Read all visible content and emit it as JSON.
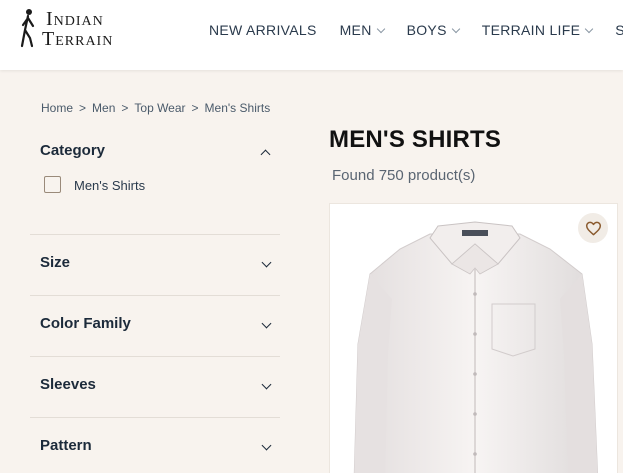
{
  "brand": {
    "line1": "Indian",
    "line2": "Terrain"
  },
  "nav": {
    "items": [
      {
        "label": "NEW ARRIVALS",
        "has_dropdown": false
      },
      {
        "label": "MEN",
        "has_dropdown": true
      },
      {
        "label": "BOYS",
        "has_dropdown": true
      },
      {
        "label": "TERRAIN LIFE",
        "has_dropdown": true
      },
      {
        "label": "SU",
        "has_dropdown": false
      }
    ]
  },
  "breadcrumb": {
    "items": [
      "Home",
      "Men",
      "Top Wear",
      "Men's Shirts"
    ],
    "separator": ">"
  },
  "filters": {
    "category": {
      "title": "Category",
      "expanded": true,
      "options": [
        {
          "label": "Men's Shirts",
          "checked": false
        }
      ]
    },
    "size": {
      "title": "Size",
      "expanded": false
    },
    "color_family": {
      "title": "Color Family",
      "expanded": false
    },
    "sleeves": {
      "title": "Sleeves",
      "expanded": false
    },
    "pattern": {
      "title": "Pattern",
      "expanded": false
    }
  },
  "listing": {
    "title": "MEN'S SHIRTS",
    "count_text": "Found 750 product(s)"
  },
  "product": {
    "wishlist_icon": "heart-icon",
    "image": "white-shirt"
  },
  "colors": {
    "page_bg": "#f8f3ee",
    "header_bg": "#ffffff",
    "text_dark": "#1c2a3a",
    "heart": "#8a5a2e"
  }
}
